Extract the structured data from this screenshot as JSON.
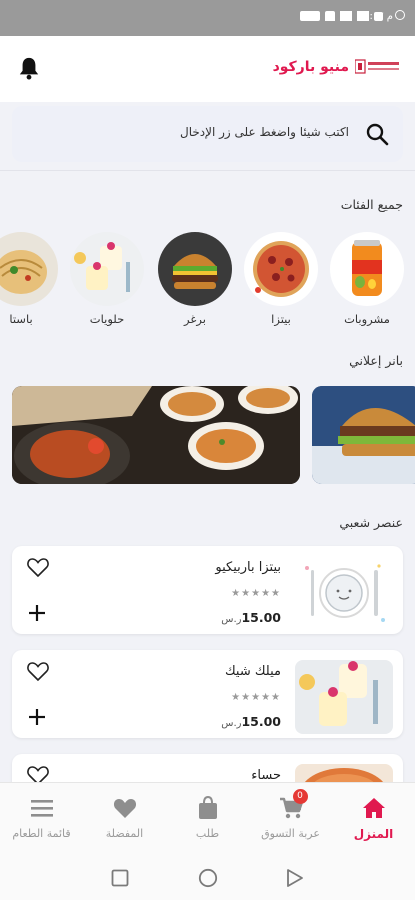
{
  "status_bar": {
    "time": "۱۲:۱۷ م",
    "battery": "88"
  },
  "header": {
    "brand": "منيو باركود",
    "logo_text": "منيو باركود"
  },
  "search": {
    "placeholder": "اكتب شيئا واضغط على زر الإدخال"
  },
  "categories_section": {
    "title": "جميع الفئات",
    "items": [
      {
        "label": "مشروبات",
        "icon": "soda-can"
      },
      {
        "label": "بيتزا",
        "icon": "pizza"
      },
      {
        "label": "برغر",
        "icon": "burger"
      },
      {
        "label": "حلويات",
        "icon": "dessert"
      },
      {
        "label": "باستا",
        "icon": "pasta"
      }
    ]
  },
  "banner_section": {
    "title": "بانر إعلاني"
  },
  "popular_section": {
    "title": "عنصر شعبي",
    "items": [
      {
        "name": "بيتزا باربيكيو",
        "stars": "★★★★★",
        "price": "15.00",
        "currency": "ر.س"
      },
      {
        "name": "ميلك شيك",
        "stars": "★★★★★",
        "price": "15.00",
        "currency": "ر.س"
      },
      {
        "name": "حساء"
      }
    ]
  },
  "bottom_nav": {
    "items": [
      {
        "label": "المنزل",
        "icon": "home-icon",
        "active": true
      },
      {
        "label": "عربة التسوق",
        "icon": "cart-icon",
        "badge": "0"
      },
      {
        "label": "طلب",
        "icon": "bag-icon"
      },
      {
        "label": "المفضلة",
        "icon": "heart-icon"
      },
      {
        "label": "قائمة الطعام",
        "icon": "menu-icon"
      }
    ]
  },
  "colors": {
    "accent": "#e0194f",
    "background": "#f1f2f7",
    "card": "#ffffff",
    "inactive": "#9a9a9a"
  }
}
